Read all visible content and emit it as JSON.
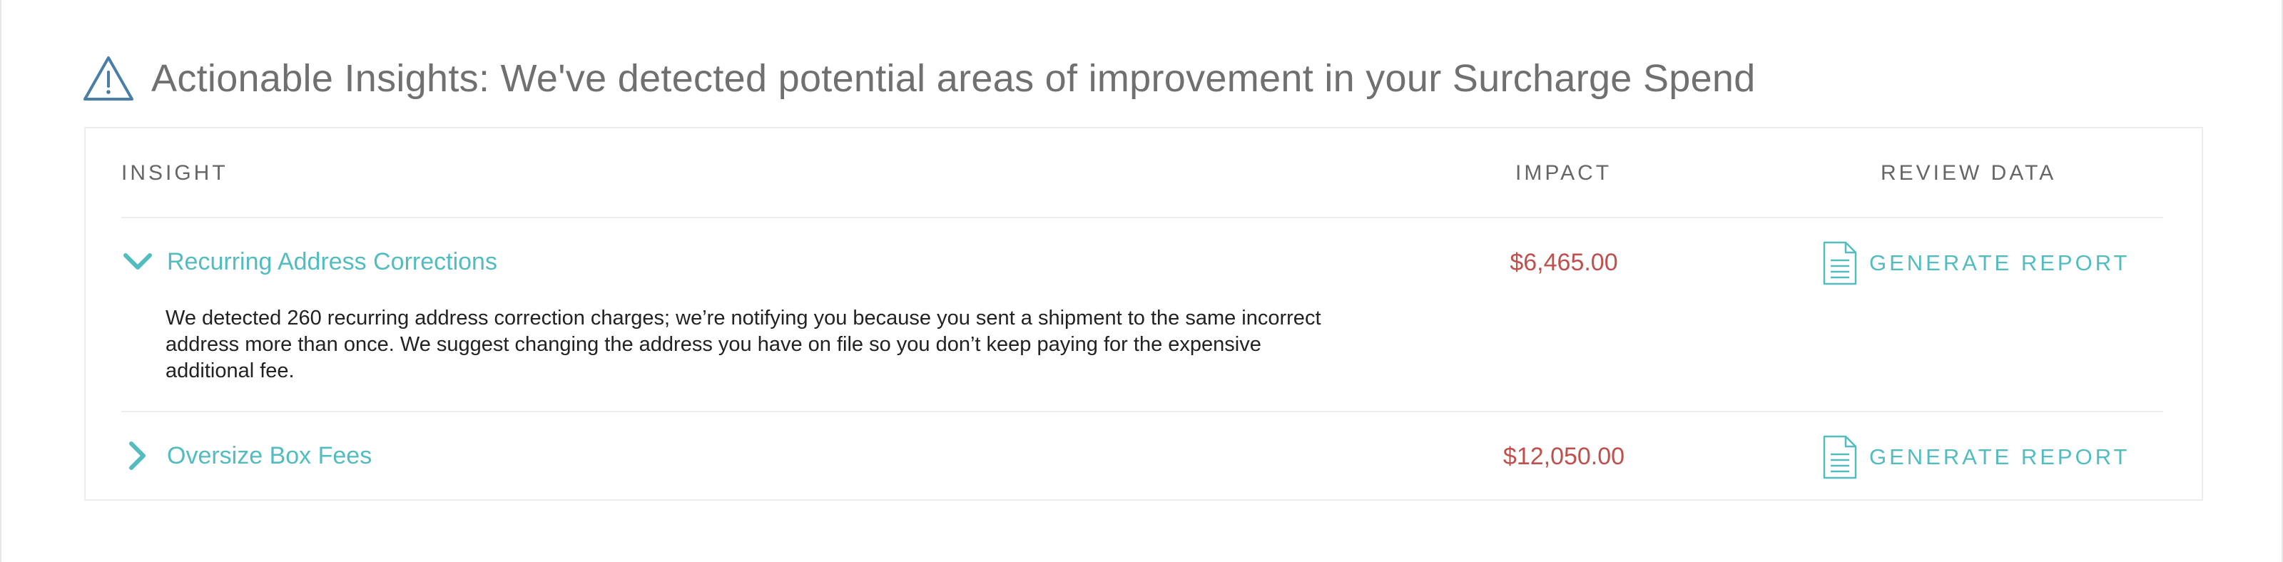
{
  "header": {
    "title": "Actionable Insights: We've detected potential areas of improvement in your Surcharge Spend",
    "icon": "warning-triangle-icon"
  },
  "table": {
    "columns": [
      "INSIGHT",
      "IMPACT",
      "REVIEW DATA"
    ],
    "rows": [
      {
        "title": "Recurring Address Corrections",
        "impact": "$6,465.00",
        "action_label": "GENERATE REPORT",
        "expanded": true,
        "description": "We detected 260 recurring address correction charges; we’re notifying you because you sent a shipment to the same incorrect address more than once. We suggest changing the address you have on file so you don’t keep paying for the expensive additional fee."
      },
      {
        "title": "Oversize Box Fees",
        "impact": "$12,050.00",
        "action_label": "GENERATE REPORT",
        "expanded": false
      }
    ]
  },
  "colors": {
    "accent": "#52bcbf",
    "impact": "#c0504d",
    "heading": "#707070",
    "icon": "#4a7ea6"
  }
}
